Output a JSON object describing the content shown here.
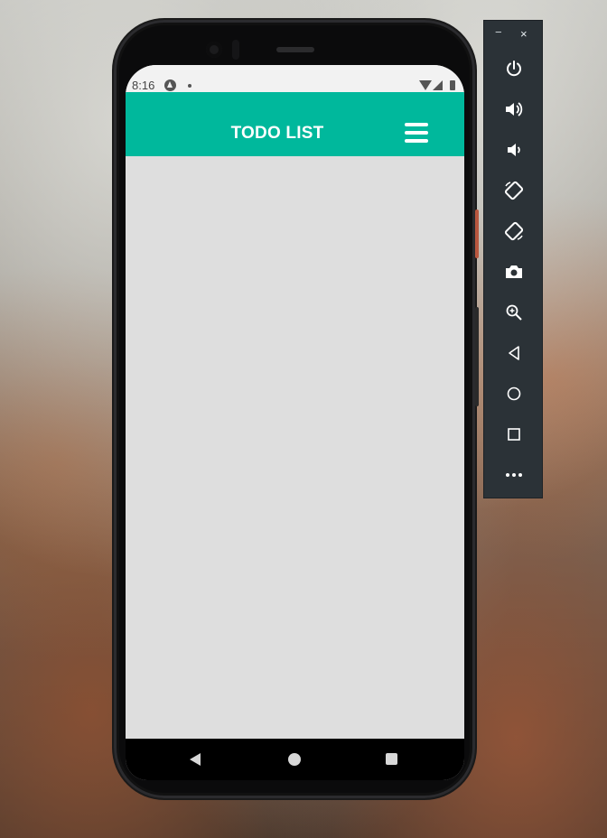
{
  "status_bar": {
    "time": "8:16"
  },
  "app": {
    "title": "TODO LIST",
    "accent_color": "#00b89c",
    "content_background": "#dedede",
    "add_button_label": "+"
  },
  "emulator_panel": {
    "minimize_label": "−",
    "close_label": "×",
    "tools": [
      "power-icon",
      "volume-up-icon",
      "volume-down-icon",
      "rotate-left-icon",
      "rotate-right-icon",
      "camera-icon",
      "zoom-icon",
      "back-icon",
      "home-icon",
      "overview-icon",
      "more-icon"
    ]
  },
  "nav_bar": {
    "icons": [
      "back-triangle-icon",
      "home-circle-icon",
      "recents-square-icon"
    ]
  }
}
